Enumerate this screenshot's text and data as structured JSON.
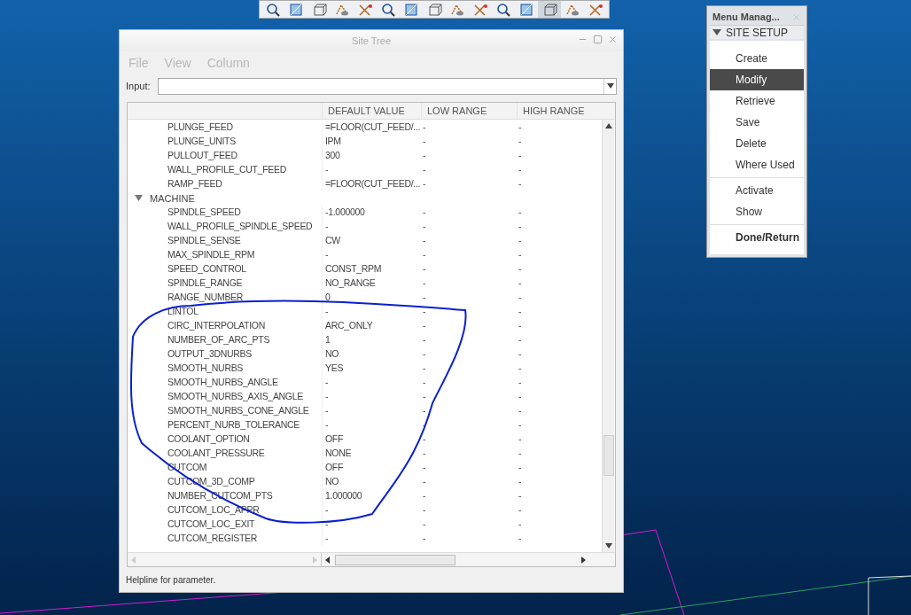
{
  "site_tree": {
    "title": "Site Tree",
    "menu": [
      {
        "label": "File",
        "disabled": true
      },
      {
        "label": "View",
        "disabled": true
      },
      {
        "label": "Column",
        "disabled": true
      }
    ],
    "input": {
      "label": "Input:"
    },
    "columns": [
      "DEFAULT VALUE",
      "LOW RANGE",
      "HIGH RANGE"
    ],
    "tree": [
      {
        "children": [
          {
            "name": "PLUNGE_FEED",
            "default": "=FLOOR(CUT_FEED/...",
            "low": "-",
            "high": "-"
          },
          {
            "name": "PLUNGE_UNITS",
            "default": "IPM",
            "low": "-",
            "high": "-"
          },
          {
            "name": "PULLOUT_FEED",
            "default": "300",
            "low": "-",
            "high": "-"
          },
          {
            "name": "WALL_PROFILE_CUT_FEED",
            "default": "-",
            "low": "-",
            "high": "-"
          },
          {
            "name": "RAMP_FEED",
            "default": "=FLOOR(CUT_FEED/...",
            "low": "-",
            "high": "-"
          }
        ]
      },
      {
        "label": "MACHINE",
        "expanded": true,
        "children": [
          {
            "name": "SPINDLE_SPEED",
            "default": "-1.000000",
            "low": "-",
            "high": "-"
          },
          {
            "name": "WALL_PROFILE_SPINDLE_SPEED",
            "default": "-",
            "low": "-",
            "high": "-"
          },
          {
            "name": "SPINDLE_SENSE",
            "default": "CW",
            "low": "-",
            "high": "-"
          },
          {
            "name": "MAX_SPINDLE_RPM",
            "default": "-",
            "low": "-",
            "high": "-"
          },
          {
            "name": "SPEED_CONTROL",
            "default": "CONST_RPM",
            "low": "-",
            "high": "-"
          },
          {
            "name": "SPINDLE_RANGE",
            "default": "NO_RANGE",
            "low": "-",
            "high": "-"
          },
          {
            "name": "RANGE_NUMBER",
            "default": "0",
            "low": "-",
            "high": "-"
          },
          {
            "name": "LINTOL",
            "default": "-",
            "low": "-",
            "high": "-"
          },
          {
            "name": "CIRC_INTERPOLATION",
            "default": "ARC_ONLY",
            "low": "-",
            "high": "-"
          },
          {
            "name": "NUMBER_OF_ARC_PTS",
            "default": "1",
            "low": "-",
            "high": "-"
          },
          {
            "name": "OUTPUT_3DNURBS",
            "default": "NO",
            "low": "-",
            "high": "-"
          },
          {
            "name": "SMOOTH_NURBS",
            "default": "YES",
            "low": "-",
            "high": "-"
          },
          {
            "name": "SMOOTH_NURBS_ANGLE",
            "default": "-",
            "low": "-",
            "high": "-"
          },
          {
            "name": "SMOOTH_NURBS_AXIS_ANGLE",
            "default": "-",
            "low": "-",
            "high": "-"
          },
          {
            "name": "SMOOTH_NURBS_CONE_ANGLE",
            "default": "-",
            "low": "-",
            "high": "-"
          },
          {
            "name": "PERCENT_NURB_TOLERANCE",
            "default": "-",
            "low": "-",
            "high": "-"
          },
          {
            "name": "COOLANT_OPTION",
            "default": "OFF",
            "low": "-",
            "high": "-"
          },
          {
            "name": "COOLANT_PRESSURE",
            "default": "NONE",
            "low": "-",
            "high": "-"
          },
          {
            "name": "CUTCOM",
            "default": "OFF",
            "low": "-",
            "high": "-"
          },
          {
            "name": "CUTCOM_3D_COMP",
            "default": "NO",
            "low": "-",
            "high": "-"
          },
          {
            "name": "NUMBER_CUTCOM_PTS",
            "default": "1.000000",
            "low": "-",
            "high": "-"
          },
          {
            "name": "CUTCOM_LOC_APPR",
            "default": "-",
            "low": "-",
            "high": "-"
          },
          {
            "name": "CUTCOM_LOC_EXIT",
            "default": "-",
            "low": "-",
            "high": "-"
          },
          {
            "name": "CUTCOM_REGISTER",
            "default": "-",
            "low": "-",
            "high": "-"
          }
        ]
      }
    ],
    "status_bar": "Helpline for parameter."
  },
  "menu_manager": {
    "title": "Menu Manag...",
    "section": {
      "label": "SITE SETUP",
      "expanded": true
    },
    "groups": [
      [
        {
          "label": "Create",
          "kind": "option",
          "selected": false
        },
        {
          "label": "Modify",
          "kind": "option",
          "selected": true
        },
        {
          "label": "Retrieve",
          "kind": "option",
          "selected": false
        },
        {
          "label": "Save",
          "kind": "option",
          "selected": false
        },
        {
          "label": "Delete",
          "kind": "option",
          "selected": false
        },
        {
          "label": "Where Used",
          "kind": "option",
          "selected": false
        }
      ],
      [
        {
          "label": "Activate",
          "kind": "option",
          "selected": false
        },
        {
          "label": "Show",
          "kind": "option",
          "selected": false
        }
      ],
      [
        {
          "label": "Done/Return",
          "kind": "command",
          "selected": false
        }
      ]
    ]
  }
}
